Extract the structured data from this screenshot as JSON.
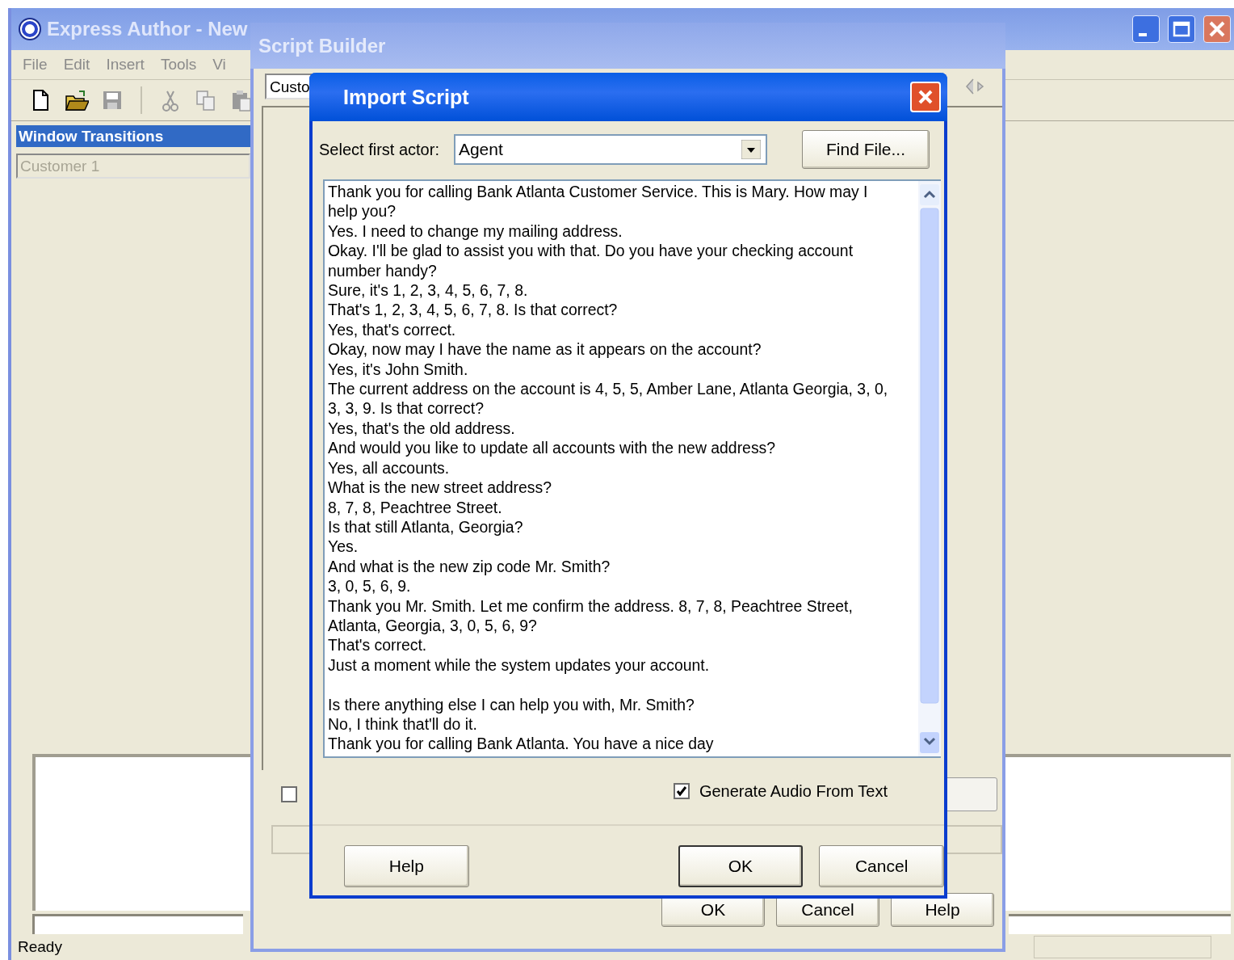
{
  "main_window": {
    "title": "Express Author - New",
    "menu": [
      "File",
      "Edit",
      "Insert",
      "Tools",
      "Vi"
    ],
    "toolbar": [
      {
        "kind": "new",
        "disabled": false
      },
      {
        "kind": "open",
        "disabled": false
      },
      {
        "kind": "save",
        "disabled": true
      },
      {
        "kind": "cut",
        "disabled": true
      },
      {
        "kind": "copy",
        "disabled": true
      },
      {
        "kind": "paste",
        "disabled": true
      }
    ],
    "panel": [
      {
        "label": "Window Transitions",
        "selected": true,
        "disabled": false
      },
      {
        "label": "Customer 1",
        "selected": false,
        "disabled": true
      }
    ],
    "status_bar": "Ready"
  },
  "script_builder": {
    "title": "Script Builder",
    "combo": "Custo",
    "checkbox": {
      "checked": false
    },
    "buttons": [
      "OK",
      "Cancel",
      "Help"
    ]
  },
  "import_dialog": {
    "title": "Import Script",
    "actor_label": "Select first actor:",
    "actor": "Agent",
    "find_button": "Find File...",
    "script": [
      {
        "lines": [
          "Thank you for calling Bank Atlanta Customer Service. This is Mary. How may I help you?",
          "Yes. I need to change my mailing address.",
          "Okay. I'll be glad to assist you with that. Do you have your checking account number handy?",
          "Sure, it's 1, 2, 3, 4, 5, 6, 7, 8.",
          "That's 1, 2, 3, 4, 5, 6, 7, 8. Is that correct?",
          "Yes, that's correct.",
          "Okay, now may I have the name as it appears on the account?",
          "Yes, it's John Smith.",
          "The current address on the account is 4, 5, 5, Amber Lane, Atlanta Georgia, 3, 0, 3, 3, 9. Is that correct?",
          "Yes, that's the old address.",
          "And would you like to update all accounts with the new address?",
          "Yes, all accounts.",
          "What is the new street address?",
          "8, 7, 8, Peachtree Street.",
          "Is that still Atlanta, Georgia?",
          "Yes.",
          "And what is the new zip code Mr. Smith?",
          "3, 0, 5, 6, 9.",
          "Thank you Mr. Smith. Let me confirm the address. 8, 7, 8, Peachtree Street, Atlanta, Georgia, 3, 0, 5, 6, 9?",
          "That's correct.",
          "Just a moment while the system updates your account."
        ]
      },
      {
        "lines": [
          "Is there anything else I can help you with, Mr. Smith?",
          "No, I think that'll do it.",
          "Thank you for calling Bank Atlanta. You have a nice day"
        ]
      }
    ],
    "generate_audio": {
      "label": "Generate Audio From Text",
      "checked": true
    },
    "buttons": [
      {
        "label": "Help",
        "default": false
      },
      {
        "label": "OK",
        "default": true
      },
      {
        "label": "Cancel",
        "default": false
      }
    ]
  }
}
